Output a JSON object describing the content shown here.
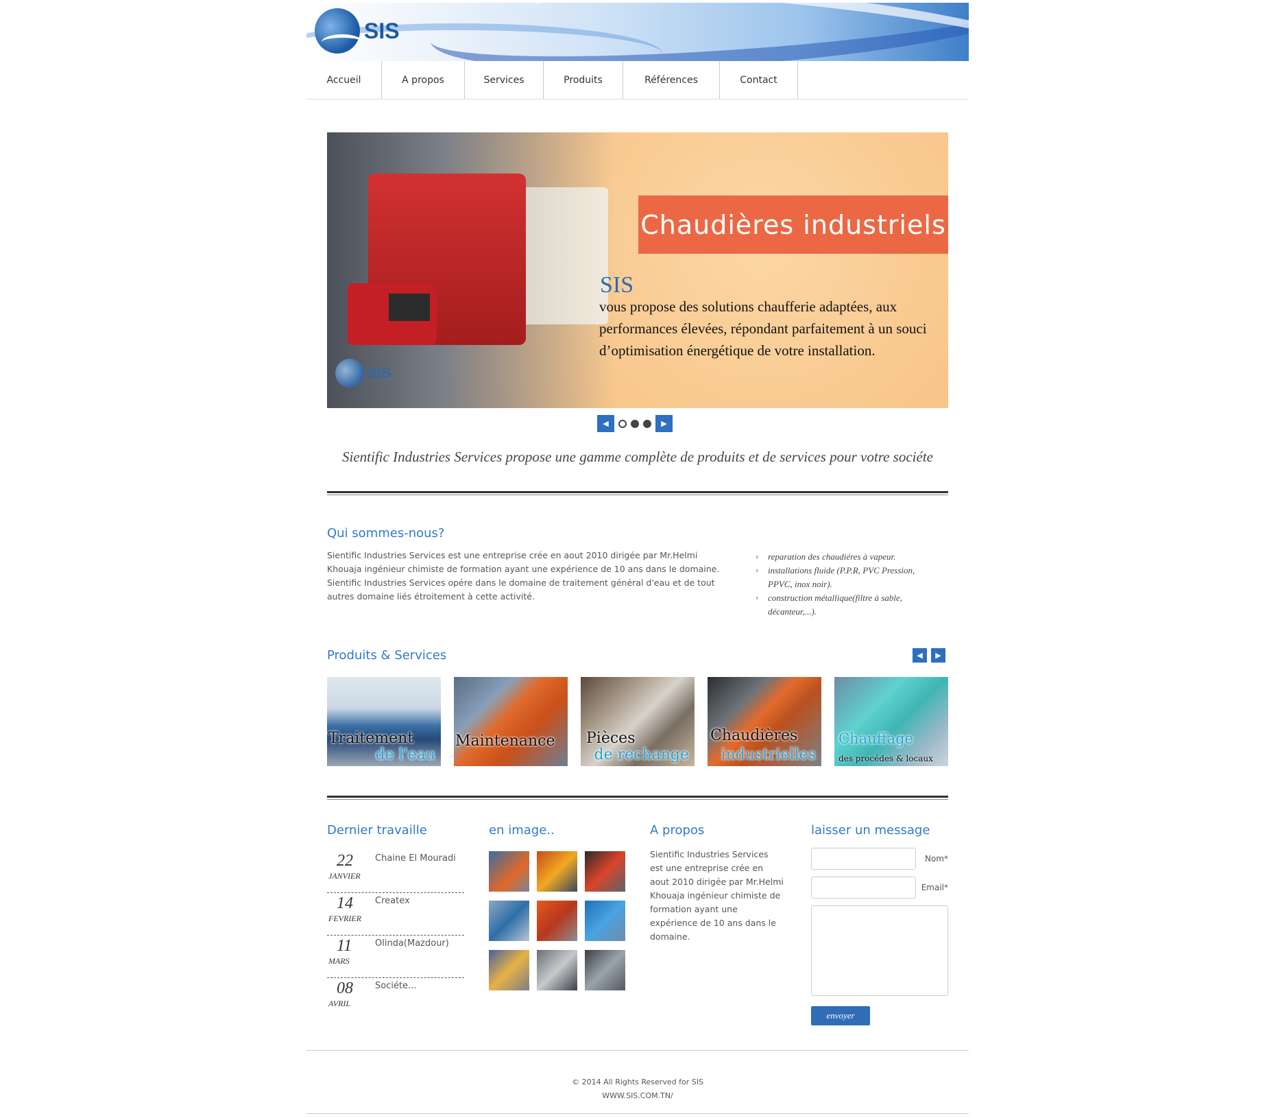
{
  "header": {
    "logo_text": "SIS"
  },
  "nav": {
    "items": [
      {
        "label": "Accueil",
        "width": 110
      },
      {
        "label": "A propos",
        "width": 121
      },
      {
        "label": "Services",
        "width": 115
      },
      {
        "label": "Produits",
        "width": 116
      },
      {
        "label": "Références",
        "width": 141
      },
      {
        "label": "Contact",
        "width": 114
      }
    ]
  },
  "slider": {
    "banner": "Chaudières industriels",
    "brand": "SIS",
    "text": "vous propose des solutions chaufferie adaptées, aux performances élevées, répondant parfaitement à un souci d’optimisation énergétique de votre installation.",
    "logo_text": "SIS",
    "prev_icon": "◀",
    "next_icon": "▶"
  },
  "tagline": "Sientific Industries Services propose une gamme complète de produits et de services pour votre sociéte",
  "about": {
    "title": "Qui sommes-nous?",
    "text": "Sientific Industries Services est une entreprise crée en aout 2010 dirigée par Mr.Helmi Khouaja ingénieur chimiste de formation ayant une expérience de 10 ans dans le domaine. Sientific Industries Services opére dans le domaine de traitement général d'eau et de tout autres domaine liés étroitement à cette activité.",
    "list": [
      "reparation des chaudiéres à vapeur.",
      "installations fluide (P.P.R, PVC Pression, PPVC, inox noir).",
      "construction métallique(filtre à sable, décanteur,...)."
    ]
  },
  "products": {
    "title": "Produits & Services",
    "tiles": [
      {
        "line1": "Traitement",
        "line2": "de l'eau"
      },
      {
        "line1": "Maintenance",
        "line2": ""
      },
      {
        "line1": "Pièces",
        "line2": "de rechange"
      },
      {
        "line1": "Chaudières",
        "line2": "industrielles"
      },
      {
        "line1": "",
        "line2": "Chauffage",
        "line3": "des procédes & locaux"
      }
    ]
  },
  "footer_cols": {
    "news_title": "Dernier travaille",
    "news": [
      {
        "day": "22",
        "month": "JANVIER",
        "title": "Chaine El Mouradi"
      },
      {
        "day": "14",
        "month": "FEVRIER",
        "title": "Createx"
      },
      {
        "day": "11",
        "month": "MARS",
        "title": "Olinda(Mazdour)"
      },
      {
        "day": "08",
        "month": "AVRIL",
        "title": "Sociéte..."
      }
    ],
    "gallery_title": "en image..",
    "apropos_title": "A propos",
    "apropos_text": "Sientific Industries Services est une entreprise crée en aout 2010 dirigée par Mr.Helmi Khouaja ingénieur chimiste de formation ayant une expérience de 10 ans dans le domaine.",
    "message_title": "laisser un message",
    "form": {
      "name_label": "Nom*",
      "email_label": "Email*",
      "send_label": "envoyer"
    }
  },
  "footer": {
    "copyright": "© 2014 All Rights Reserved for SIS",
    "url": "WWW.SIS.COM.TN/"
  }
}
